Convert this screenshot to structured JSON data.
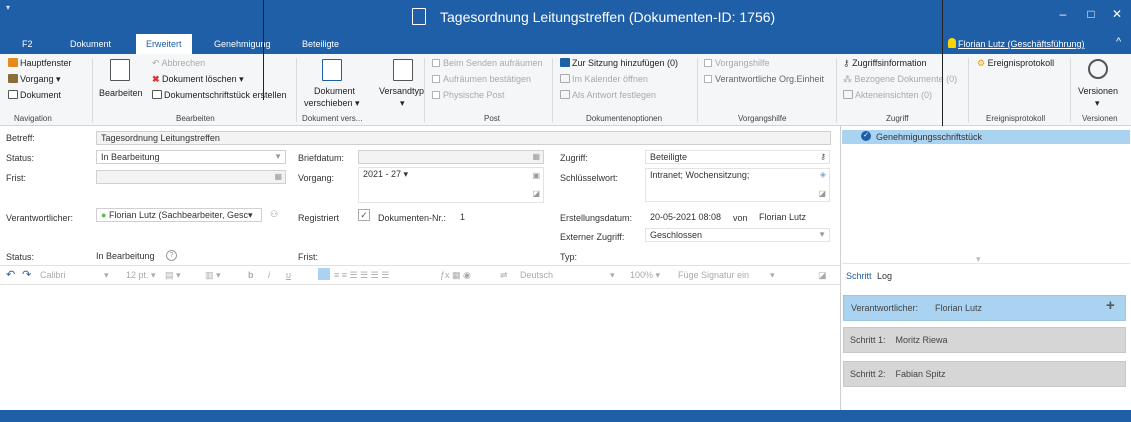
{
  "window": {
    "title": "Tagesordnung Leitungstreffen (Dokumenten-ID: 1756)",
    "minimize": "–",
    "maximize": "□",
    "close": "✕",
    "quick_access": "▾"
  },
  "tabs": [
    {
      "label": "F2"
    },
    {
      "label": "Dokument"
    },
    {
      "label": "Erweitert"
    },
    {
      "label": "Genehmigung"
    },
    {
      "label": "Beteiligte"
    }
  ],
  "active_tab": "Erweitert",
  "user": {
    "name": "Florian Lutz (Geschäftsführung)"
  },
  "ribbon": {
    "navigation": {
      "items": [
        "Hauptfenster",
        "Vorgang ▾",
        "Dokument"
      ],
      "label": "Navigation"
    },
    "bearbeiten": {
      "big_button": "Bearbeiten",
      "abbrechen": "Abbrechen",
      "loeschen": "Dokument löschen ▾",
      "schriftstueck": "Dokumentschriftstück erstellen",
      "label": "Bearbeiten"
    },
    "dokument_vers": {
      "button_line1": "Dokument",
      "button_line2": "verschieben ▾",
      "versandtyp": "Versandtyp",
      "versandtyp_arrow": "▾",
      "label": "Dokument vers..."
    },
    "post": {
      "items": [
        "Beim Senden aufräumen",
        "Aufräumen bestätigen",
        "Physische Post"
      ],
      "label": "Post"
    },
    "dokumentenoptionen": {
      "sitzung": "Zur Sitzung hinzufügen (0)",
      "kalender": "Im Kalender öffnen",
      "antwort": "Als Antwort festlegen",
      "label": "Dokumentenoptionen"
    },
    "vorgangshilfe": {
      "items": [
        "Vorgangshilfe",
        "Verantwortliche Org.Einheit"
      ],
      "label": "Vorgangshilfe"
    },
    "zugriff": {
      "info": "Zugriffsinformation",
      "bezogen": "Bezogene Dokumente (0)",
      "akten": "Akteneinsichten (0)",
      "label": "Zugriff"
    },
    "ereignisprotokoll": {
      "button": "Ereignisprotokoll",
      "label": "Ereignisprotokoll"
    },
    "versionen": {
      "button": "Versionen",
      "arrow": "▾",
      "label": "Versionen"
    }
  },
  "form": {
    "betreff_label": "Betreff:",
    "betreff": "Tagesordnung Leitungstreffen",
    "status_label": "Status:",
    "status": "In Bearbeitung",
    "frist_label": "Frist:",
    "frist": "",
    "verantwortlicher_label": "Verantwortlicher:",
    "verantwortlicher": "Florian Lutz (Sachbearbeiter, Gesc▾",
    "briefdatum_label": "Briefdatum:",
    "vorgang_label": "Vorgang:",
    "vorgang": "2021 - 27 ▾",
    "registriert_label": "Registriert",
    "dokumenten_nr_label": "Dokumenten-Nr.:",
    "dokumenten_nr": "1",
    "zugriff_label": "Zugriff:",
    "zugriff": "Beteiligte",
    "schluesselwort_label": "Schlüsselwort:",
    "schluesselwort": "Intranet; Wochensitzung;",
    "erstellungsdatum_label": "Erstellungsdatum:",
    "erstellungsdatum": "20-05-2021 08:08",
    "von_label": "von",
    "von": "Florian Lutz",
    "externer_zugriff_label": "Externer Zugriff:",
    "externer_zugriff": "Geschlossen",
    "status2_label": "Status:",
    "status2": "In Bearbeitung",
    "frist2_label": "Frist:",
    "typ_label": "Typ:"
  },
  "editor_toolbar": {
    "undo": "↶",
    "redo": "↷",
    "font": "Calibri",
    "size": "12 pt. ▾",
    "bold": "b",
    "italic": "i",
    "underline": "u",
    "language": "Deutsch",
    "zoom": "100% ▾",
    "signatur": "Füge Signatur ein"
  },
  "right_panel": {
    "approval": "Genehmigungsschriftstück",
    "tabs": [
      "Schritt",
      "Log"
    ],
    "expand": "▾",
    "verantwortlicher_label": "Verantwortlicher:",
    "verantwortlicher": "Florian Lutz",
    "add": "+",
    "steps": [
      {
        "label": "Schritt 1:",
        "name": "Moritz Riewa"
      },
      {
        "label": "Schritt 2:",
        "name": "Fabian Spitz"
      }
    ]
  },
  "colors": {
    "accent": "#1e5fa7",
    "selection": "#a9d3f0",
    "delete": "#d9342b"
  }
}
